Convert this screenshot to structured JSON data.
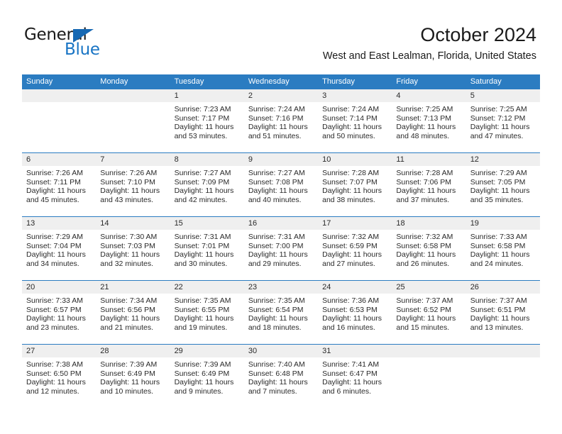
{
  "brand": {
    "name_part1": "General",
    "name_part2": "Blue",
    "accent_color": "#1874c4",
    "triangle_color": "#1668b3"
  },
  "header": {
    "month_title": "October 2024",
    "location": "West and East Lealman, Florida, United States"
  },
  "calendar": {
    "header_bg": "#2b7cc1",
    "daynum_bg": "#efefef",
    "weekdays": [
      "Sunday",
      "Monday",
      "Tuesday",
      "Wednesday",
      "Thursday",
      "Friday",
      "Saturday"
    ],
    "weeks": [
      [
        {
          "day": "",
          "sunrise": "",
          "sunset": "",
          "daylight_line1": "",
          "daylight_line2": ""
        },
        {
          "day": "",
          "sunrise": "",
          "sunset": "",
          "daylight_line1": "",
          "daylight_line2": ""
        },
        {
          "day": "1",
          "sunrise": "Sunrise: 7:23 AM",
          "sunset": "Sunset: 7:17 PM",
          "daylight_line1": "Daylight: 11 hours",
          "daylight_line2": "and 53 minutes."
        },
        {
          "day": "2",
          "sunrise": "Sunrise: 7:24 AM",
          "sunset": "Sunset: 7:16 PM",
          "daylight_line1": "Daylight: 11 hours",
          "daylight_line2": "and 51 minutes."
        },
        {
          "day": "3",
          "sunrise": "Sunrise: 7:24 AM",
          "sunset": "Sunset: 7:14 PM",
          "daylight_line1": "Daylight: 11 hours",
          "daylight_line2": "and 50 minutes."
        },
        {
          "day": "4",
          "sunrise": "Sunrise: 7:25 AM",
          "sunset": "Sunset: 7:13 PM",
          "daylight_line1": "Daylight: 11 hours",
          "daylight_line2": "and 48 minutes."
        },
        {
          "day": "5",
          "sunrise": "Sunrise: 7:25 AM",
          "sunset": "Sunset: 7:12 PM",
          "daylight_line1": "Daylight: 11 hours",
          "daylight_line2": "and 47 minutes."
        }
      ],
      [
        {
          "day": "6",
          "sunrise": "Sunrise: 7:26 AM",
          "sunset": "Sunset: 7:11 PM",
          "daylight_line1": "Daylight: 11 hours",
          "daylight_line2": "and 45 minutes."
        },
        {
          "day": "7",
          "sunrise": "Sunrise: 7:26 AM",
          "sunset": "Sunset: 7:10 PM",
          "daylight_line1": "Daylight: 11 hours",
          "daylight_line2": "and 43 minutes."
        },
        {
          "day": "8",
          "sunrise": "Sunrise: 7:27 AM",
          "sunset": "Sunset: 7:09 PM",
          "daylight_line1": "Daylight: 11 hours",
          "daylight_line2": "and 42 minutes."
        },
        {
          "day": "9",
          "sunrise": "Sunrise: 7:27 AM",
          "sunset": "Sunset: 7:08 PM",
          "daylight_line1": "Daylight: 11 hours",
          "daylight_line2": "and 40 minutes."
        },
        {
          "day": "10",
          "sunrise": "Sunrise: 7:28 AM",
          "sunset": "Sunset: 7:07 PM",
          "daylight_line1": "Daylight: 11 hours",
          "daylight_line2": "and 38 minutes."
        },
        {
          "day": "11",
          "sunrise": "Sunrise: 7:28 AM",
          "sunset": "Sunset: 7:06 PM",
          "daylight_line1": "Daylight: 11 hours",
          "daylight_line2": "and 37 minutes."
        },
        {
          "day": "12",
          "sunrise": "Sunrise: 7:29 AM",
          "sunset": "Sunset: 7:05 PM",
          "daylight_line1": "Daylight: 11 hours",
          "daylight_line2": "and 35 minutes."
        }
      ],
      [
        {
          "day": "13",
          "sunrise": "Sunrise: 7:29 AM",
          "sunset": "Sunset: 7:04 PM",
          "daylight_line1": "Daylight: 11 hours",
          "daylight_line2": "and 34 minutes."
        },
        {
          "day": "14",
          "sunrise": "Sunrise: 7:30 AM",
          "sunset": "Sunset: 7:03 PM",
          "daylight_line1": "Daylight: 11 hours",
          "daylight_line2": "and 32 minutes."
        },
        {
          "day": "15",
          "sunrise": "Sunrise: 7:31 AM",
          "sunset": "Sunset: 7:01 PM",
          "daylight_line1": "Daylight: 11 hours",
          "daylight_line2": "and 30 minutes."
        },
        {
          "day": "16",
          "sunrise": "Sunrise: 7:31 AM",
          "sunset": "Sunset: 7:00 PM",
          "daylight_line1": "Daylight: 11 hours",
          "daylight_line2": "and 29 minutes."
        },
        {
          "day": "17",
          "sunrise": "Sunrise: 7:32 AM",
          "sunset": "Sunset: 6:59 PM",
          "daylight_line1": "Daylight: 11 hours",
          "daylight_line2": "and 27 minutes."
        },
        {
          "day": "18",
          "sunrise": "Sunrise: 7:32 AM",
          "sunset": "Sunset: 6:58 PM",
          "daylight_line1": "Daylight: 11 hours",
          "daylight_line2": "and 26 minutes."
        },
        {
          "day": "19",
          "sunrise": "Sunrise: 7:33 AM",
          "sunset": "Sunset: 6:58 PM",
          "daylight_line1": "Daylight: 11 hours",
          "daylight_line2": "and 24 minutes."
        }
      ],
      [
        {
          "day": "20",
          "sunrise": "Sunrise: 7:33 AM",
          "sunset": "Sunset: 6:57 PM",
          "daylight_line1": "Daylight: 11 hours",
          "daylight_line2": "and 23 minutes."
        },
        {
          "day": "21",
          "sunrise": "Sunrise: 7:34 AM",
          "sunset": "Sunset: 6:56 PM",
          "daylight_line1": "Daylight: 11 hours",
          "daylight_line2": "and 21 minutes."
        },
        {
          "day": "22",
          "sunrise": "Sunrise: 7:35 AM",
          "sunset": "Sunset: 6:55 PM",
          "daylight_line1": "Daylight: 11 hours",
          "daylight_line2": "and 19 minutes."
        },
        {
          "day": "23",
          "sunrise": "Sunrise: 7:35 AM",
          "sunset": "Sunset: 6:54 PM",
          "daylight_line1": "Daylight: 11 hours",
          "daylight_line2": "and 18 minutes."
        },
        {
          "day": "24",
          "sunrise": "Sunrise: 7:36 AM",
          "sunset": "Sunset: 6:53 PM",
          "daylight_line1": "Daylight: 11 hours",
          "daylight_line2": "and 16 minutes."
        },
        {
          "day": "25",
          "sunrise": "Sunrise: 7:37 AM",
          "sunset": "Sunset: 6:52 PM",
          "daylight_line1": "Daylight: 11 hours",
          "daylight_line2": "and 15 minutes."
        },
        {
          "day": "26",
          "sunrise": "Sunrise: 7:37 AM",
          "sunset": "Sunset: 6:51 PM",
          "daylight_line1": "Daylight: 11 hours",
          "daylight_line2": "and 13 minutes."
        }
      ],
      [
        {
          "day": "27",
          "sunrise": "Sunrise: 7:38 AM",
          "sunset": "Sunset: 6:50 PM",
          "daylight_line1": "Daylight: 11 hours",
          "daylight_line2": "and 12 minutes."
        },
        {
          "day": "28",
          "sunrise": "Sunrise: 7:39 AM",
          "sunset": "Sunset: 6:49 PM",
          "daylight_line1": "Daylight: 11 hours",
          "daylight_line2": "and 10 minutes."
        },
        {
          "day": "29",
          "sunrise": "Sunrise: 7:39 AM",
          "sunset": "Sunset: 6:49 PM",
          "daylight_line1": "Daylight: 11 hours",
          "daylight_line2": "and 9 minutes."
        },
        {
          "day": "30",
          "sunrise": "Sunrise: 7:40 AM",
          "sunset": "Sunset: 6:48 PM",
          "daylight_line1": "Daylight: 11 hours",
          "daylight_line2": "and 7 minutes."
        },
        {
          "day": "31",
          "sunrise": "Sunrise: 7:41 AM",
          "sunset": "Sunset: 6:47 PM",
          "daylight_line1": "Daylight: 11 hours",
          "daylight_line2": "and 6 minutes."
        },
        {
          "day": "",
          "sunrise": "",
          "sunset": "",
          "daylight_line1": "",
          "daylight_line2": ""
        },
        {
          "day": "",
          "sunrise": "",
          "sunset": "",
          "daylight_line1": "",
          "daylight_line2": ""
        }
      ]
    ]
  }
}
